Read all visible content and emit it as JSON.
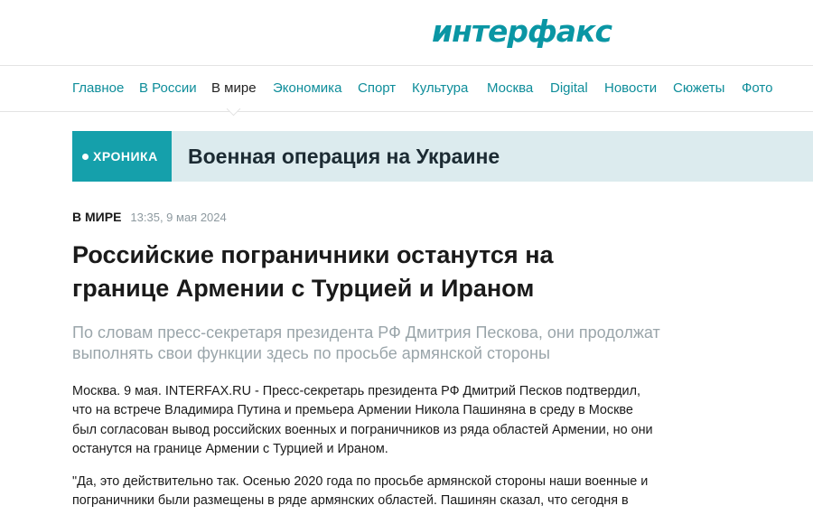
{
  "logo": {
    "text": "интерфакс",
    "color": "#0a96a4"
  },
  "nav": {
    "items": [
      {
        "label": "Главное",
        "active": false
      },
      {
        "label": "В России",
        "active": false
      },
      {
        "label": "В мире",
        "active": true
      },
      {
        "label": "Экономика",
        "active": false
      },
      {
        "label": "Спорт",
        "active": false
      },
      {
        "label": "Культура",
        "active": false
      },
      {
        "label": "Москва",
        "active": false
      },
      {
        "label": "Digital",
        "active": false
      },
      {
        "label": "Новости",
        "active": false
      },
      {
        "label": "Сюжеты",
        "active": false
      },
      {
        "label": "Фото",
        "active": false
      }
    ]
  },
  "banner": {
    "tag": "ХРОНИКА",
    "title": "Военная операция на Украине",
    "tag_color": "#15a0ab",
    "background": "#dcebee"
  },
  "article": {
    "rubric": "В МИРЕ",
    "date": "13:35, 9 мая 2024",
    "headline": "Российские пограничники останутся на границе Армении с Турцией и Ираном",
    "lead": "По словам пресс-секретаря президента РФ Дмитрия Пескова, они продолжат выполнять свои функции здесь по просьбе армянской стороны",
    "paragraphs": [
      "Москва. 9 мая. INTERFAX.RU - Пресс-секретарь президента РФ Дмитрий Песков подтвердил, что на встрече Владимира Путина и премьера Армении Никола Пашиняна в среду в Москве был согласован вывод российских военных и пограничников из ряда областей Армении, но они останутся на границе Армении с Турцией и Ираном.",
      "\"Да, это действительно так. Осенью 2020 года по просьбе армянской стороны наши военные и пограничники были размещены в ряде армянских областей. Пашинян сказал, что сегодня в"
    ]
  }
}
